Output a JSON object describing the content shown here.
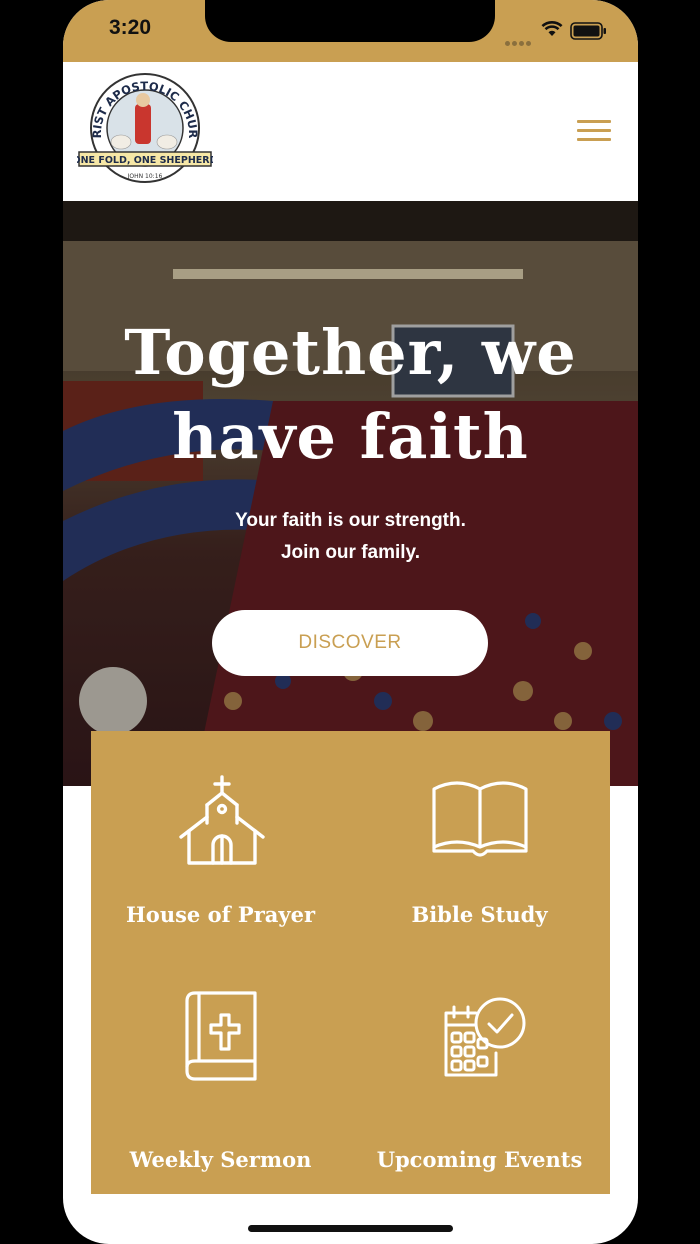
{
  "status_bar": {
    "time": "3:20"
  },
  "header": {
    "logo": {
      "church_name": "CHRIST APOSTOLIC CHURCH",
      "motto": "ONE FOLD, ONE SHEPHERD",
      "verse": "JOHN 10:16"
    },
    "menu_icon": "hamburger-menu-icon"
  },
  "hero": {
    "title_line1": "Together, we",
    "title_line2": "have faith",
    "subtitle_line1": "Your faith is our strength.",
    "subtitle_line2": "Join our family.",
    "button_label": "DISCOVER"
  },
  "services": [
    {
      "label": "House of Prayer",
      "icon": "church-icon"
    },
    {
      "label": "Bible Study",
      "icon": "open-book-icon"
    },
    {
      "label": "Weekly Sermon",
      "icon": "bible-cross-icon"
    },
    {
      "label": "Upcoming Events",
      "icon": "calendar-check-icon"
    }
  ],
  "colors": {
    "accent": "#C99F52",
    "text_light": "#FFFFFF"
  }
}
